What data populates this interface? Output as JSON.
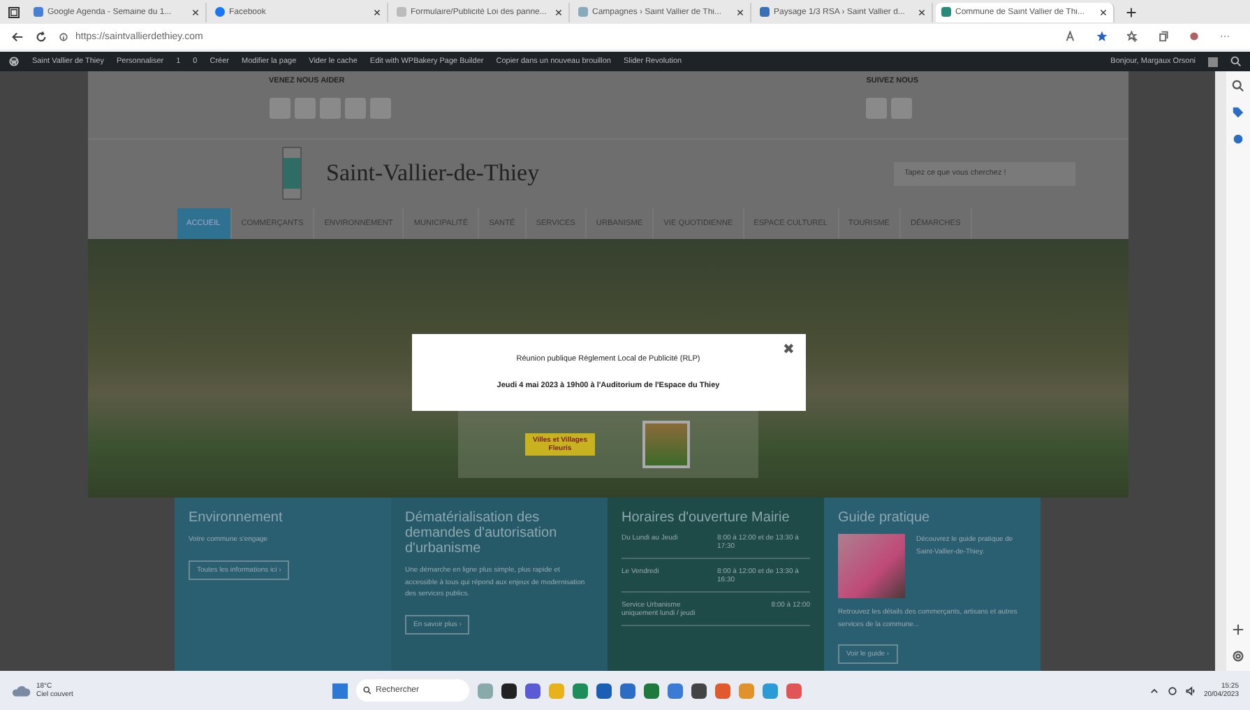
{
  "browser": {
    "tabs": [
      {
        "title": "Google Agenda - Semaine du 1...",
        "selected": false
      },
      {
        "title": "Facebook",
        "selected": false
      },
      {
        "title": "Formulaire/Publicité Loi des panne...",
        "selected": false
      },
      {
        "title": "Campagnes › Saint Vallier de Thi...",
        "selected": false
      },
      {
        "title": "Paysage 1/3 RSA › Saint Vallier d...",
        "selected": false
      },
      {
        "title": "Commune de Saint Vallier de Thi...",
        "selected": true
      }
    ],
    "url": "https://saintvallierdethiey.com"
  },
  "admin_bar": {
    "items": [
      "Saint Vallier de Thiey",
      "Personnaliser",
      "1",
      "0",
      "Créer",
      "Modifier la page",
      "Vider le cache",
      "Edit with WPBakery Page Builder",
      "Copier dans un nouveau brouillon",
      "Slider Revolution"
    ],
    "greeting": "Bonjour, Margaux Orsoni"
  },
  "site": {
    "top_left_label": "VENEZ NOUS AIDER",
    "top_right_label": "SUIVEZ NOUS",
    "title": "Saint-Vallier-de-Thiey",
    "search": {
      "placeholder": "Tapez ce que vous cherchez !"
    },
    "nav": [
      {
        "label": "ACCUEIL",
        "selected": true
      },
      {
        "label": "COMMERÇANTS",
        "selected": false
      },
      {
        "label": "ENVIRONNEMENT",
        "selected": false
      },
      {
        "label": "MUNICIPALITÉ",
        "selected": false
      },
      {
        "label": "SANTÉ",
        "selected": false
      },
      {
        "label": "SERVICES",
        "selected": false
      },
      {
        "label": "URBANISME",
        "selected": false
      },
      {
        "label": "VIE QUOTIDIENNE",
        "selected": false
      },
      {
        "label": "ESPACE CULTUREL",
        "selected": false
      },
      {
        "label": "TOURISME",
        "selected": false
      },
      {
        "label": "DÉMARCHES",
        "selected": false
      }
    ],
    "modal": {
      "title": "Réunion publique Règlement Local de Publicité (RLP)",
      "subtitle": "Jeudi 4 mai 2023 à 19h00 à l'Auditorium de l'Espace du Thiey",
      "close": "✖"
    },
    "badge": "Villes et Villages Fleuris",
    "panels": [
      {
        "kind": "text",
        "title": "Environnement",
        "text": "Votre commune s'engage",
        "button": "Toutes les informations ici ›"
      },
      {
        "kind": "text",
        "title": "Dématérialisation des demandes d'autorisation d'urbanisme",
        "text": "Une démarche en ligne plus simple, plus rapide et accessible à tous qui répond aux enjeux de modernisation des services publics.",
        "button": "En savoir plus ›"
      },
      {
        "kind": "hours",
        "title": "Horaires d'ouverture Mairie",
        "rows": [
          {
            "label": "Du Lundi au Jeudi",
            "hours": "8:00 à 12:00 et de 13:30 à 17:30"
          },
          {
            "label": "Le Vendredi",
            "hours": "8:00 à 12:00 et de 13:30 à 16:30"
          },
          {
            "label": "Service Urbanisme uniquement lundi / jeudi",
            "hours": "8:00 à 12:00"
          }
        ]
      },
      {
        "kind": "guide",
        "title": "Guide pratique",
        "text": "Découvrez le guide pratique de Saint-Vallier-de-Thiey.",
        "text2": "Retrouvez les détails des commerçants, artisans et autres services de la commune...",
        "button": "Voir le guide ›"
      }
    ]
  },
  "taskbar": {
    "temperature": "18°C",
    "weather": "Ciel couvert",
    "search": {
      "placeholder": "Rechercher"
    },
    "time": "15:25",
    "date": "20/04/2023"
  }
}
